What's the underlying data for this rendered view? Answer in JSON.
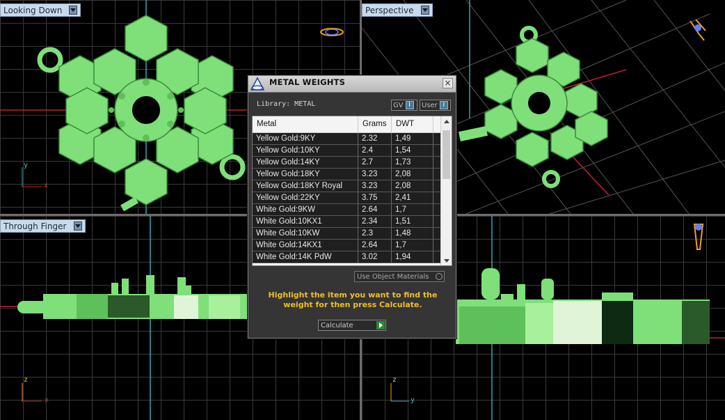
{
  "viewports": {
    "top": {
      "label": "Looking Down"
    },
    "perspective": {
      "label": "Perspective"
    },
    "front": {
      "label": "Through Finger"
    },
    "side": {
      "label": ""
    }
  },
  "axes": {
    "top": {
      "v": "y",
      "h": "x"
    },
    "front": {
      "v": "z",
      "h": "x"
    },
    "side": {
      "v": "z",
      "h": "y"
    }
  },
  "dialog": {
    "title": "METAL WEIGHTS",
    "library": "Library: METAL",
    "toggle_gv": "GV",
    "toggle_user": "User",
    "columns": [
      "Metal",
      "Grams",
      "DWT"
    ],
    "rows": [
      [
        "Yellow Gold:9KY",
        "2.32",
        "1,49"
      ],
      [
        "Yellow Gold:10KY",
        "2.4",
        "1,54"
      ],
      [
        "Yellow Gold:14KY",
        "2.7",
        "1,73"
      ],
      [
        "Yellow Gold:18KY",
        "3.23",
        "2,08"
      ],
      [
        "Yellow Gold:18KY Royal",
        "3.23",
        "2,08"
      ],
      [
        "Yellow Gold:22KY",
        "3.75",
        "2,41"
      ],
      [
        "White Gold:9KW",
        "2.64",
        "1,7"
      ],
      [
        "White Gold:10KX1",
        "2.34",
        "1,51"
      ],
      [
        "White Gold:10KW",
        "2.3",
        "1,48"
      ],
      [
        "White Gold:14KX1",
        "2.64",
        "1,7"
      ],
      [
        "White Gold:14K PdW",
        "3.02",
        "1,94"
      ]
    ],
    "use_object_materials": "Use Object Materials",
    "hint": "Highlight the item you want to find the weight for then press Calculate.",
    "calculate": "Calculate"
  },
  "colors": {
    "model_green": "#7fe07a",
    "axis_red": "#c8202a",
    "axis_cyan": "#2fa8b8",
    "hint_yellow": "#f0c020"
  }
}
